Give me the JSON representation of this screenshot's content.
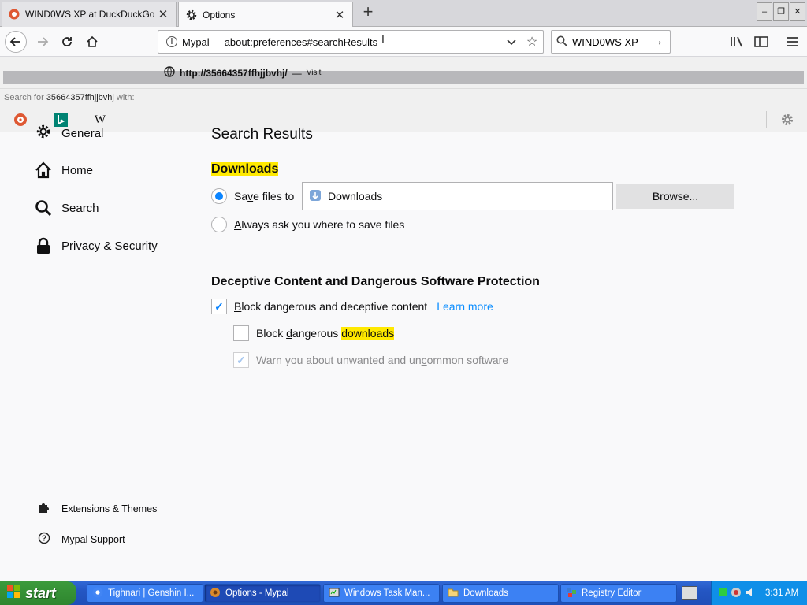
{
  "browser": {
    "tabs": [
      {
        "label": "WIND0WS XP at DuckDuckGo",
        "icon": "duckduckgo-icon"
      },
      {
        "label": "Options",
        "icon": "gear-icon"
      }
    ],
    "url_identity": "Mypal",
    "url": "about:preferences#searchResults",
    "search_value": "WIND0WS XP",
    "colors": {
      "accent": "#0a84ff",
      "highlight": "#ffe900"
    }
  },
  "search_popup": {
    "visit_url": "http://35664357ffhjjbvhj/",
    "visit_sep": "—",
    "visit_label": "Visit",
    "search_for_prefix": "Search for",
    "search_for_query": "35664357ffhjjbvhj",
    "search_for_suffix": "with:",
    "engines": [
      "duckduckgo",
      "bing",
      "wikipedia"
    ],
    "wiki_letter": "W"
  },
  "sidebar": {
    "items": [
      {
        "label": "General",
        "icon": "gear-icon"
      },
      {
        "label": "Home",
        "icon": "home-icon"
      },
      {
        "label": "Search",
        "icon": "search-icon"
      },
      {
        "label": "Privacy & Security",
        "icon": "lock-icon"
      }
    ],
    "footer": [
      {
        "label": "Extensions & Themes",
        "icon": "puzzle-icon"
      },
      {
        "label": "Mypal Support",
        "icon": "help-icon"
      }
    ]
  },
  "main": {
    "title": "Search Results",
    "downloads": {
      "heading": "Downloads",
      "save_label_pre": "Sa",
      "save_label_u": "v",
      "save_label_post": "e files to",
      "folder": "Downloads",
      "browse": "Browse...",
      "ask_u": "A",
      "ask_post": "lways ask you where to save files"
    },
    "protection": {
      "heading": "Deceptive Content and Dangerous Software Protection",
      "block_u": "B",
      "block_post": "lock dangerous and deceptive content",
      "learn_more": "Learn more",
      "block_dl_pre": "Block ",
      "block_dl_u": "d",
      "block_dl_mid": "angerous ",
      "block_dl_hl": "downloads",
      "warn_pre": "Warn you about unwanted and un",
      "warn_u": "c",
      "warn_post": "ommon software"
    }
  },
  "taskbar": {
    "start": "start",
    "items": [
      {
        "label": "Tighnari | Genshin I...",
        "icon": "chrome-icon"
      },
      {
        "label": "Options - Mypal",
        "icon": "mypal-icon"
      },
      {
        "label": "Windows Task Man...",
        "icon": "task-manager-icon"
      },
      {
        "label": "Downloads",
        "icon": "folder-icon"
      },
      {
        "label": "Registry Editor",
        "icon": "regedit-icon"
      }
    ],
    "clock": "3:31 AM"
  }
}
